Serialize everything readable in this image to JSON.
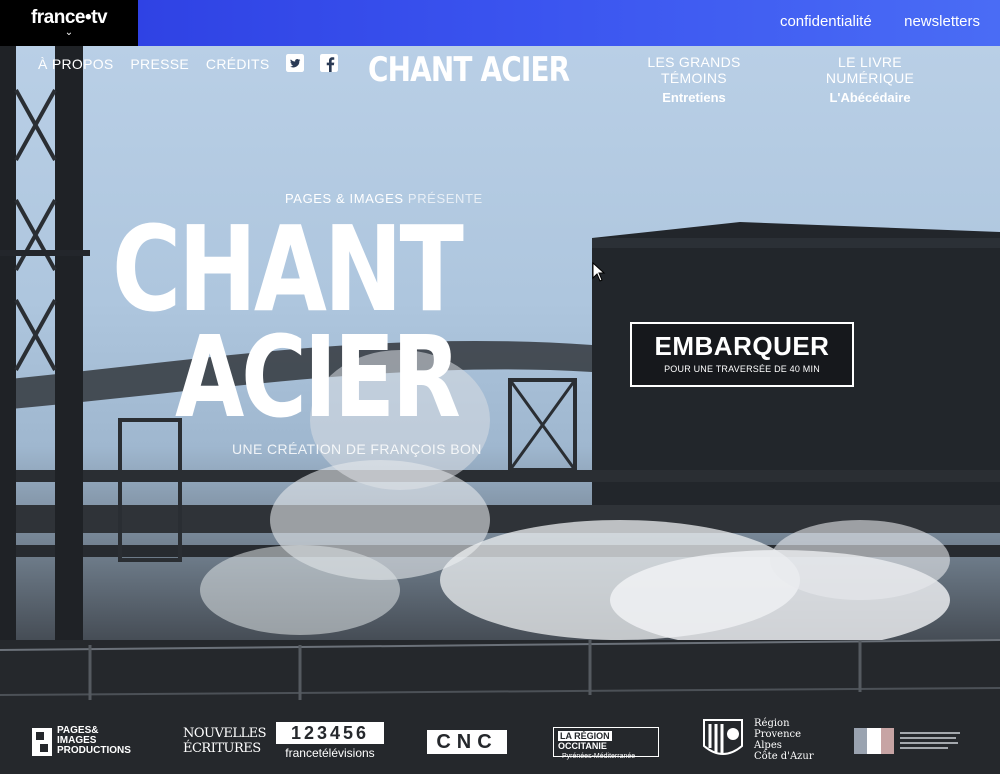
{
  "topbar": {
    "brand": "france•tv",
    "links": [
      "confidentialité",
      "newsletters"
    ]
  },
  "nav": {
    "left": [
      "À PROPOS",
      "PRESSE",
      "CRÉDITS"
    ],
    "social_icons": [
      "twitter-icon",
      "facebook-icon"
    ],
    "logo": "CHANT ACIER",
    "right": [
      {
        "title": "LES GRANDS TÉMOINS",
        "subtitle": "Entretiens"
      },
      {
        "title": "LE LIVRE NUMÉRIQUE",
        "subtitle": "L'Abécédaire"
      }
    ]
  },
  "hero": {
    "presents_a": "PAGES & IMAGES",
    "presents_b": "PRÉSENTE",
    "title_line1": "CHANT",
    "title_line2": "ACIER",
    "creation_a": "UNE CRÉATION DE",
    "creation_b": "FRANÇOIS BON"
  },
  "cta": {
    "label": "EMBARQUER",
    "sub": "POUR UNE TRAVERSÉE DE 40 MIN"
  },
  "partners": {
    "pages_images": [
      "PAGES&",
      "IMAGES",
      "PRODUCTIONS"
    ],
    "nouvelles_ecritures": [
      "NOUVELLES",
      "ÉCRITURES"
    ],
    "france_tv_digits": "123456",
    "france_tv_label": "francetélévisions",
    "cnc": "CNC",
    "region_occitanie": [
      "LA RÉGION",
      "OCCITANIE",
      "Pyrénées-Méditerranée"
    ],
    "region_paca": [
      "Région",
      "Provence",
      "Alpes",
      "Côte d'Azur"
    ]
  },
  "colors": {
    "topbar": "#3b55f0",
    "brand_bg": "#000000",
    "text": "#ffffff"
  }
}
